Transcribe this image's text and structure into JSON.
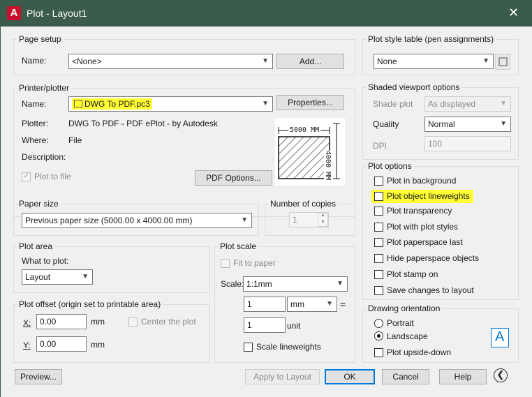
{
  "window": {
    "title": "Plot - Layout1",
    "app_icon_letter": "A"
  },
  "page_setup": {
    "group_label": "Page setup",
    "name_label": "Name:",
    "name_value": "<None>",
    "add_button": "Add..."
  },
  "printer": {
    "group_label": "Printer/plotter",
    "name_label": "Name:",
    "name_value": "DWG To PDF.pc3",
    "properties_button": "Properties...",
    "plotter_label": "Plotter:",
    "plotter_value": "DWG To PDF - PDF ePlot - by Autodesk",
    "where_label": "Where:",
    "where_value": "File",
    "description_label": "Description:",
    "plot_to_file_label": "Plot to file",
    "pdf_options_button": "PDF Options...",
    "preview_width_label": "5000 MM",
    "preview_height_label": "4000 MM"
  },
  "paper_size": {
    "group_label": "Paper size",
    "value": "Previous paper size  (5000.00 x 4000.00 mm)"
  },
  "copies": {
    "group_label": "Number of copies",
    "value": "1"
  },
  "plot_area": {
    "group_label": "Plot area",
    "what_label": "What to plot:",
    "value": "Layout"
  },
  "plot_offset": {
    "group_label": "Plot offset (origin set to printable area)",
    "x_label": "X:",
    "x_value": "0.00",
    "x_unit": "mm",
    "y_label": "Y:",
    "y_value": "0.00",
    "y_unit": "mm",
    "center_label": "Center the plot"
  },
  "plot_scale": {
    "group_label": "Plot scale",
    "fit_label": "Fit to paper",
    "scale_label": "Scale:",
    "scale_value": "1:1mm",
    "value1": "1",
    "unit1": "mm",
    "equals": "=",
    "value2": "1",
    "unit2": "unit",
    "lineweights_label": "Scale lineweights"
  },
  "plot_style": {
    "group_label": "Plot style table (pen assignments)",
    "value": "None"
  },
  "shaded": {
    "group_label": "Shaded viewport options",
    "shade_label": "Shade plot",
    "shade_value": "As displayed",
    "quality_label": "Quality",
    "quality_value": "Normal",
    "dpi_label": "DPI",
    "dpi_value": "100"
  },
  "plot_options": {
    "group_label": "Plot options",
    "items": [
      "Plot in background",
      "Plot object lineweights",
      "Plot transparency",
      "Plot with plot styles",
      "Plot paperspace last",
      "Hide paperspace objects",
      "Plot stamp on",
      "Save changes to layout"
    ]
  },
  "orientation": {
    "group_label": "Drawing orientation",
    "portrait": "Portrait",
    "landscape": "Landscape",
    "upside_down": "Plot upside-down",
    "icon_letter": "A"
  },
  "footer": {
    "preview_button": "Preview...",
    "apply_button": "Apply to Layout",
    "ok_button": "OK",
    "cancel_button": "Cancel",
    "help_button": "Help"
  },
  "colors": {
    "titlebar": "#3b5b4b",
    "highlight": "#ffff33",
    "accent": "#0078d7",
    "app_icon": "#c8102e"
  }
}
